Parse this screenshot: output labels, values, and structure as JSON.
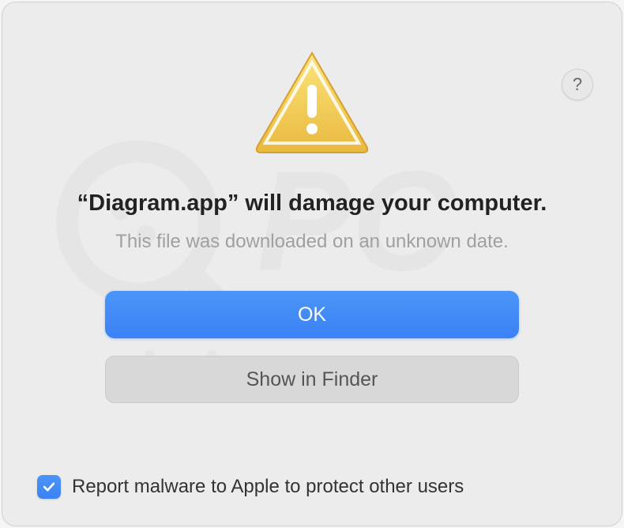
{
  "dialog": {
    "title": "“Diagram.app” will damage your computer.",
    "subtitle": "This file was downloaded on an unknown date.",
    "help_label": "?",
    "buttons": {
      "ok": "OK",
      "show_in_finder": "Show in Finder"
    },
    "checkbox": {
      "checked": true,
      "label": "Report malware to Apple to protect other users"
    }
  },
  "icons": {
    "warning": "warning-triangle",
    "help": "question-mark",
    "checkmark": "check"
  },
  "colors": {
    "primary": "#3b82f6",
    "background": "#ececec",
    "text": "#222",
    "subtext": "#a0a0a0"
  }
}
